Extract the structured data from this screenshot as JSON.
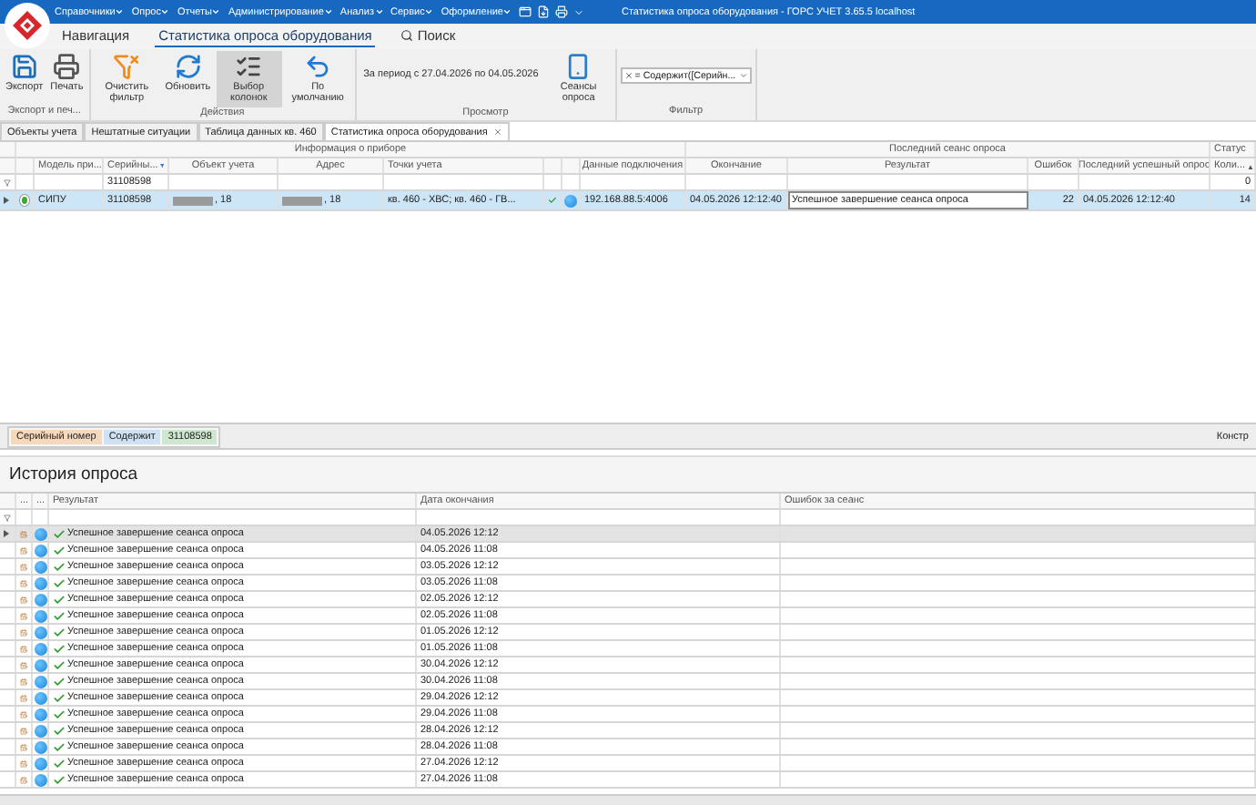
{
  "window": {
    "title": "Статистика опроса оборудования - ГОРС УЧЕТ 3.65.5 localhost"
  },
  "menu": [
    {
      "label": "Справочники"
    },
    {
      "label": "Опрос"
    },
    {
      "label": "Отчеты"
    },
    {
      "label": "Администрирование"
    },
    {
      "label": "Анализ"
    },
    {
      "label": "Сервис"
    },
    {
      "label": "Оформление"
    }
  ],
  "ribbon_tabs": [
    {
      "label": "Навигация",
      "selected": false,
      "kind": "tab"
    },
    {
      "label": "Статистика опроса оборудования",
      "selected": true,
      "kind": "tab"
    },
    {
      "label": "Поиск",
      "selected": false,
      "kind": "search"
    }
  ],
  "ribbon_groups": [
    {
      "label": "Экспорт и печ...",
      "items": [
        {
          "kind": "button",
          "label": "Экспорт",
          "pressed": false
        },
        {
          "kind": "button",
          "label": "Печать",
          "pressed": false
        }
      ]
    },
    {
      "label": "Действия",
      "items": [
        {
          "kind": "button",
          "label": "Очистить фильтр",
          "pressed": false
        },
        {
          "kind": "button",
          "label": "Обновить",
          "pressed": false
        },
        {
          "kind": "button",
          "label": "Выбор колонок",
          "pressed": true
        },
        {
          "kind": "button",
          "label": "По умолчанию",
          "pressed": false
        }
      ]
    },
    {
      "label": "Просмотр",
      "items": [
        {
          "kind": "text",
          "label": "За период с 27.04.2026 по 04.05.2026"
        },
        {
          "kind": "button",
          "label": "Сеансы опроса",
          "pressed": false
        }
      ]
    },
    {
      "label": "Фильтр",
      "items": [
        {
          "kind": "combo",
          "label": "= Содержит([Серийн..."
        }
      ]
    }
  ],
  "doc_tabs": [
    {
      "label": "Объекты учета",
      "selected": false
    },
    {
      "label": "Нештатные ситуации",
      "selected": false
    },
    {
      "label": "Таблица данных кв. 460",
      "selected": false
    },
    {
      "label": "Статистика опроса оборудования",
      "selected": true
    }
  ],
  "grid": {
    "bands": [
      {
        "label": "Информация о приборе"
      },
      {
        "label": "Последний сеанс опроса"
      },
      {
        "label": "Статус"
      }
    ],
    "columns": [
      {
        "label": "Модель при..."
      },
      {
        "label": "Серийны...",
        "filtered": true,
        "filter": "31108598"
      },
      {
        "label": "Объект учета"
      },
      {
        "label": "Адрес"
      },
      {
        "label": "Точки учета"
      },
      {
        "label": "Данные подключения"
      },
      {
        "label": "Окончание"
      },
      {
        "label": "Результат"
      },
      {
        "label": "Ошибок"
      },
      {
        "label": "Последний успешный опрос"
      },
      {
        "label": "Коли...",
        "sort_indicator": "▲",
        "filter": "0"
      }
    ],
    "rows": [
      {
        "selected": true,
        "color": "#3aa935",
        "cells": [
          {
            "text": "СИПУ",
            "focused": false,
            "redacted": false
          },
          {
            "text": "31108598",
            "focused": false,
            "redacted": false
          },
          {
            "text": ", 18",
            "focused": false,
            "redacted": true
          },
          {
            "text": ", 18",
            "focused": false,
            "redacted": true
          },
          {
            "text": "кв. 460 - ХВС; кв. 460 - ГВ...",
            "focused": false,
            "redacted": false
          },
          {
            "text": "192.168.88.5:4006",
            "focused": false,
            "redacted": false
          },
          {
            "text": "04.05.2026 12:12:40",
            "focused": false,
            "redacted": false
          },
          {
            "text": "Успешное завершение сеанса опроса",
            "focused": true,
            "redacted": false
          },
          {
            "text": "22",
            "focused": false,
            "redacted": false
          },
          {
            "text": "04.05.2026 12:12:40",
            "focused": false,
            "redacted": false
          },
          {
            "text": "14",
            "focused": false,
            "redacted": false
          }
        ]
      }
    ]
  },
  "filter_panel": {
    "chips": [
      {
        "kind": "field",
        "text": "Серийный номер"
      },
      {
        "kind": "operator",
        "text": "Содержит"
      },
      {
        "kind": "value",
        "text": "31108598"
      }
    ],
    "editor": "Констр"
  },
  "history": {
    "title": "История опроса",
    "columns": [
      {
        "label": "..."
      },
      {
        "label": "..."
      },
      {
        "label": "Результат"
      },
      {
        "label": "Дата окончания"
      },
      {
        "label": "Ошибок за сеанс"
      }
    ],
    "rows": [
      {
        "selected": true,
        "result": "Успешное завершение сеанса опроса",
        "date": "04.05.2026 12:12"
      },
      {
        "selected": false,
        "result": "Успешное завершение сеанса опроса",
        "date": "04.05.2026 11:08"
      },
      {
        "selected": false,
        "result": "Успешное завершение сеанса опроса",
        "date": "03.05.2026 12:12"
      },
      {
        "selected": false,
        "result": "Успешное завершение сеанса опроса",
        "date": "03.05.2026 11:08"
      },
      {
        "selected": false,
        "result": "Успешное завершение сеанса опроса",
        "date": "02.05.2026 12:12"
      },
      {
        "selected": false,
        "result": "Успешное завершение сеанса опроса",
        "date": "02.05.2026 11:08"
      },
      {
        "selected": false,
        "result": "Успешное завершение сеанса опроса",
        "date": "01.05.2026 12:12"
      },
      {
        "selected": false,
        "result": "Успешное завершение сеанса опроса",
        "date": "01.05.2026 11:08"
      },
      {
        "selected": false,
        "result": "Успешное завершение сеанса опроса",
        "date": "30.04.2026 12:12"
      },
      {
        "selected": false,
        "result": "Успешное завершение сеанса опроса",
        "date": "30.04.2026 11:08"
      },
      {
        "selected": false,
        "result": "Успешное завершение сеанса опроса",
        "date": "29.04.2026 12:12"
      },
      {
        "selected": false,
        "result": "Успешное завершение сеанса опроса",
        "date": "29.04.2026 11:08"
      },
      {
        "selected": false,
        "result": "Успешное завершение сеанса опроса",
        "date": "28.04.2026 12:12"
      },
      {
        "selected": false,
        "result": "Успешное завершение сеанса опроса",
        "date": "28.04.2026 11:08"
      },
      {
        "selected": false,
        "result": "Успешное завершение сеанса опроса",
        "date": "27.04.2026 12:12"
      },
      {
        "selected": false,
        "result": "Успешное завершение сеанса опроса",
        "date": "27.04.2026 11:08"
      }
    ]
  }
}
